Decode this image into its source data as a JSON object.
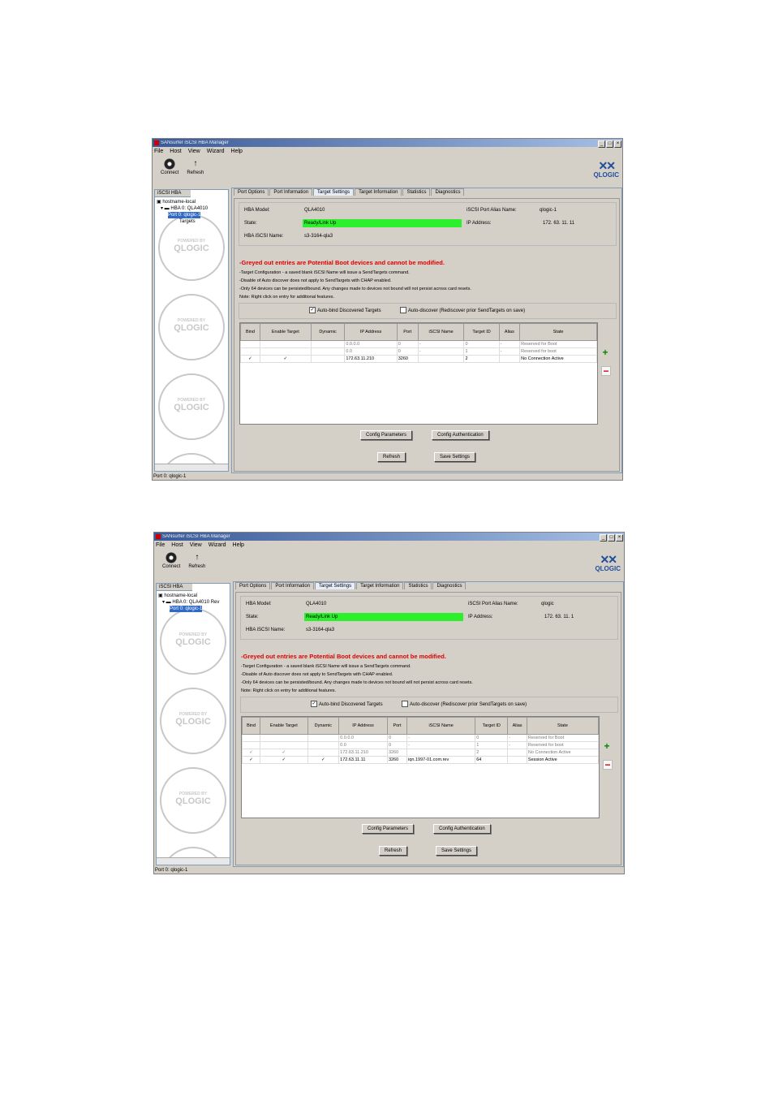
{
  "windows": [
    {
      "title": "SANsurfer iSCSI HBA Manager",
      "menu": [
        "File",
        "Host",
        "View",
        "Wizard",
        "Help"
      ],
      "toolbar": {
        "connect": "Connect",
        "refresh": "Refresh"
      },
      "logo": "QLOGIC",
      "left_tab": "iSCSI HBA",
      "tree": [
        "hostname-local",
        "HBA 0: QLA4010",
        "Port 0: qlogic-1",
        "Targets"
      ],
      "seal_text": {
        "top": "POWERED BY",
        "name": "QLOGIC"
      },
      "tabs": [
        "Port Options",
        "Port Information",
        "Target Settings",
        "Target Information",
        "Statistics",
        "Diagnostics"
      ],
      "hba_model_label": "HBA Model:",
      "hba_model": "QLA4010",
      "state_label": "State:",
      "state": "Ready/Link Up",
      "hba_name_label": "HBA iSCSI Name:",
      "hba_name": "s3-3164-qla3",
      "alias_label": "iSCSI Port Alias Name:",
      "alias": "qlogic-1",
      "ip_label": "IP Address:",
      "ip": "172. 63. 11. 11",
      "warning": "-Greyed out entries are Potential Boot devices and cannot be modified.",
      "notes": [
        "-Target Configuration - a saved blank iSCSI Name will issue a SendTargets command.",
        "-Disable of Auto discover does not apply to SendTargets with CHAP enabled.",
        "-Only 64 devices can be persisted/bound. Any changes made to devices not bound will not persist across card resets.",
        "Note: Right click on entry for additional features."
      ],
      "auto_bind": "Auto-bind Discovered Targets",
      "auto_discover": "Auto-discover (Rediscover prior SendTargets on save)",
      "columns": [
        "Bind",
        "Enable Target",
        "Dynamic",
        "IP Address",
        "Port",
        "iSCSI Name",
        "Target ID",
        "Alias",
        "State"
      ],
      "rows": [
        [
          "",
          "",
          "",
          "0.0.0.0",
          "0",
          "-",
          "0",
          "-",
          "Reserved for Boot"
        ],
        [
          "",
          "",
          "",
          "0.0",
          "0",
          "-",
          "1",
          "-",
          "Reserved for boot"
        ],
        [
          "✓",
          "✓",
          "",
          "172.63.11.210",
          "3260",
          "",
          "2",
          "",
          "No Connection Active"
        ]
      ],
      "buttons": {
        "config_params": "Config Parameters",
        "config_auth": "Config Authentication",
        "refresh": "Refresh",
        "save": "Save Settings"
      },
      "status": "Port 0: qlogic-1"
    },
    {
      "title": "SANsurfer iSCSI HBA Manager",
      "menu": [
        "File",
        "Host",
        "View",
        "Wizard",
        "Help"
      ],
      "toolbar": {
        "connect": "Connect",
        "refresh": "Refresh"
      },
      "logo": "QLOGIC",
      "left_tab": "iSCSI HBA",
      "tree": [
        "hostname-local",
        "HBA 0: QLA4010 Rev",
        "Port 0: qlogic-1",
        ""
      ],
      "seal_text": {
        "top": "POWERED BY",
        "name": "QLOGIC"
      },
      "tabs": [
        "Port Options",
        "Port Information",
        "Target Settings",
        "Target Information",
        "Statistics",
        "Diagnostics"
      ],
      "hba_model_label": "HBA Model:",
      "hba_model": "QLA4010",
      "state_label": "State:",
      "state": "Ready/Link Up",
      "hba_name_label": "HBA iSCSI Name:",
      "hba_name": "s3-3164-qla3",
      "alias_label": "iSCSI Port Alias Name:",
      "alias": "qlogic",
      "ip_label": "IP Address:",
      "ip": "172. 63. 11. 1",
      "warning": "-Greyed out entries are Potential Boot devices and cannot be modified.",
      "notes": [
        "-Target Configuration - a saved blank iSCSI Name will issue a SendTargets command.",
        "-Disable of Auto discover does not apply to SendTargets with CHAP enabled.",
        "-Only 64 devices can be persisted/bound. Any changes made to devices not bound will not persist across card resets.",
        "Note: Right click on entry for additional features."
      ],
      "auto_bind": "Auto-bind Discovered Targets",
      "auto_discover": "Auto-discover (Rediscover prior SendTargets on save)",
      "columns": [
        "Bind",
        "Enable Target",
        "Dynamic",
        "IP Address",
        "Port",
        "iSCSI Name",
        "Target ID",
        "Alias",
        "State"
      ],
      "rows": [
        [
          "",
          "",
          "",
          "0.0.0.0",
          "0",
          "-",
          "0",
          "-",
          "Reserved for Boot"
        ],
        [
          "",
          "",
          "",
          "0.0",
          "0",
          "-",
          "1",
          "-",
          "Reserved for boot"
        ],
        [
          "✓",
          "✓",
          "",
          "172.63.11.210",
          "3260",
          "",
          "2",
          "",
          "No Connection Active"
        ],
        [
          "✓",
          "✓",
          "✓",
          "172.63.11.11",
          "3260",
          "iqn.1997-01.com.rev",
          "64",
          "",
          "Session Active"
        ]
      ],
      "buttons": {
        "config_params": "Config Parameters",
        "config_auth": "Config Authentication",
        "refresh": "Refresh",
        "save": "Save Settings"
      },
      "status": "Port 0: qlogic-1"
    }
  ]
}
